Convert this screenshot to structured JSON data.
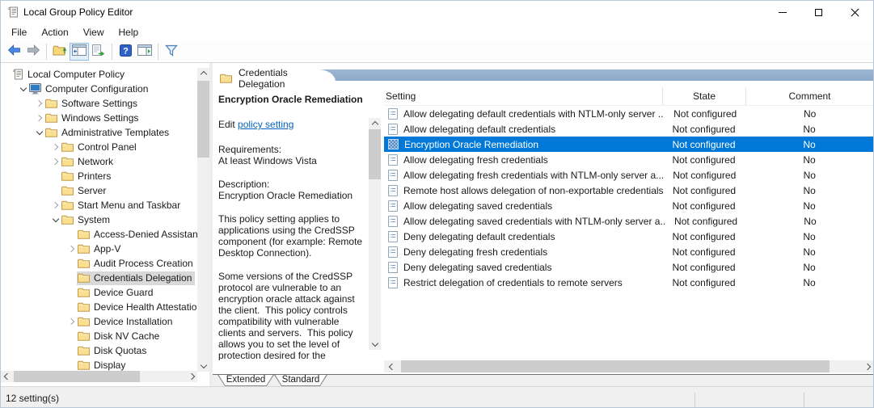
{
  "window": {
    "title": "Local Group Policy Editor"
  },
  "menu": {
    "items": [
      "File",
      "Action",
      "View",
      "Help"
    ]
  },
  "toolbar": {
    "icons": [
      "back-icon",
      "forward-icon",
      "up-level-icon",
      "console-tree-icon",
      "export-list-icon",
      "help-icon",
      "action-pane-icon",
      "filter-icon"
    ]
  },
  "tree": {
    "items": [
      {
        "label": "Local Computer Policy",
        "level": 0,
        "chevron": "none",
        "icon": "scroll",
        "selected": false
      },
      {
        "label": "Computer Configuration",
        "level": 1,
        "chevron": "expanded",
        "icon": "computer",
        "selected": false
      },
      {
        "label": "Software Settings",
        "level": 2,
        "chevron": "collapsed",
        "icon": "folder",
        "selected": false
      },
      {
        "label": "Windows Settings",
        "level": 2,
        "chevron": "collapsed",
        "icon": "folder",
        "selected": false
      },
      {
        "label": "Administrative Templates",
        "level": 2,
        "chevron": "expanded",
        "icon": "folder",
        "selected": false
      },
      {
        "label": "Control Panel",
        "level": 3,
        "chevron": "collapsed",
        "icon": "folder",
        "selected": false
      },
      {
        "label": "Network",
        "level": 3,
        "chevron": "collapsed",
        "icon": "folder",
        "selected": false
      },
      {
        "label": "Printers",
        "level": 3,
        "chevron": "none",
        "icon": "folder",
        "selected": false
      },
      {
        "label": "Server",
        "level": 3,
        "chevron": "none",
        "icon": "folder",
        "selected": false
      },
      {
        "label": "Start Menu and Taskbar",
        "level": 3,
        "chevron": "collapsed",
        "icon": "folder",
        "selected": false
      },
      {
        "label": "System",
        "level": 3,
        "chevron": "expanded",
        "icon": "folder",
        "selected": false
      },
      {
        "label": "Access-Denied Assistance",
        "level": 4,
        "chevron": "none",
        "icon": "folder",
        "selected": false
      },
      {
        "label": "App-V",
        "level": 4,
        "chevron": "collapsed",
        "icon": "folder",
        "selected": false
      },
      {
        "label": "Audit Process Creation",
        "level": 4,
        "chevron": "none",
        "icon": "folder",
        "selected": false
      },
      {
        "label": "Credentials Delegation",
        "level": 4,
        "chevron": "none",
        "icon": "folder",
        "selected": true
      },
      {
        "label": "Device Guard",
        "level": 4,
        "chevron": "none",
        "icon": "folder",
        "selected": false
      },
      {
        "label": "Device Health Attestation",
        "level": 4,
        "chevron": "none",
        "icon": "folder",
        "selected": false
      },
      {
        "label": "Device Installation",
        "level": 4,
        "chevron": "collapsed",
        "icon": "folder",
        "selected": false
      },
      {
        "label": "Disk NV Cache",
        "level": 4,
        "chevron": "none",
        "icon": "folder",
        "selected": false
      },
      {
        "label": "Disk Quotas",
        "level": 4,
        "chevron": "none",
        "icon": "folder",
        "selected": false
      },
      {
        "label": "Display",
        "level": 4,
        "chevron": "none",
        "icon": "folder",
        "selected": false
      }
    ]
  },
  "header": {
    "title": "Credentials Delegation"
  },
  "details": {
    "policy_title": "Encryption Oracle Remediation",
    "edit_prefix": "Edit ",
    "edit_link": "policy setting",
    "requirements_label": "Requirements:",
    "requirements_value": "At least Windows Vista",
    "description_label": "Description:",
    "description_title": "Encryption Oracle Remediation",
    "paragraph1": "This policy setting applies to applications using the CredSSP component (for example: Remote Desktop Connection).",
    "paragraph2": "Some versions of the CredSSP protocol are vulnerable to an encryption oracle attack against the client.  This policy controls compatibility with vulnerable clients and servers.  This policy allows you to set the level of protection desired for the"
  },
  "list": {
    "columns": [
      "Setting",
      "State",
      "Comment"
    ],
    "rows": [
      {
        "setting": "Allow delegating default credentials with NTLM-only server ...",
        "state": "Not configured",
        "comment": "No",
        "selected": false
      },
      {
        "setting": "Allow delegating default credentials",
        "state": "Not configured",
        "comment": "No",
        "selected": false
      },
      {
        "setting": "Encryption Oracle Remediation",
        "state": "Not configured",
        "comment": "No",
        "selected": true
      },
      {
        "setting": "Allow delegating fresh credentials",
        "state": "Not configured",
        "comment": "No",
        "selected": false
      },
      {
        "setting": "Allow delegating fresh credentials with NTLM-only server a...",
        "state": "Not configured",
        "comment": "No",
        "selected": false
      },
      {
        "setting": "Remote host allows delegation of non-exportable credentials",
        "state": "Not configured",
        "comment": "No",
        "selected": false
      },
      {
        "setting": "Allow delegating saved credentials",
        "state": "Not configured",
        "comment": "No",
        "selected": false
      },
      {
        "setting": "Allow delegating saved credentials with NTLM-only server a...",
        "state": "Not configured",
        "comment": "No",
        "selected": false
      },
      {
        "setting": "Deny delegating default credentials",
        "state": "Not configured",
        "comment": "No",
        "selected": false
      },
      {
        "setting": "Deny delegating fresh credentials",
        "state": "Not configured",
        "comment": "No",
        "selected": false
      },
      {
        "setting": "Deny delegating saved credentials",
        "state": "Not configured",
        "comment": "No",
        "selected": false
      },
      {
        "setting": "Restrict delegation of credentials to remote servers",
        "state": "Not configured",
        "comment": "No",
        "selected": false
      }
    ]
  },
  "tabs": {
    "items": [
      {
        "label": "Extended",
        "active": true
      },
      {
        "label": "Standard",
        "active": false
      }
    ]
  },
  "status": {
    "text": "12 setting(s)"
  },
  "colors": {
    "selection": "#0078D7",
    "tree_selection": "#D9D9D9",
    "header_band": "#93AFCB",
    "link": "#0563C1"
  }
}
